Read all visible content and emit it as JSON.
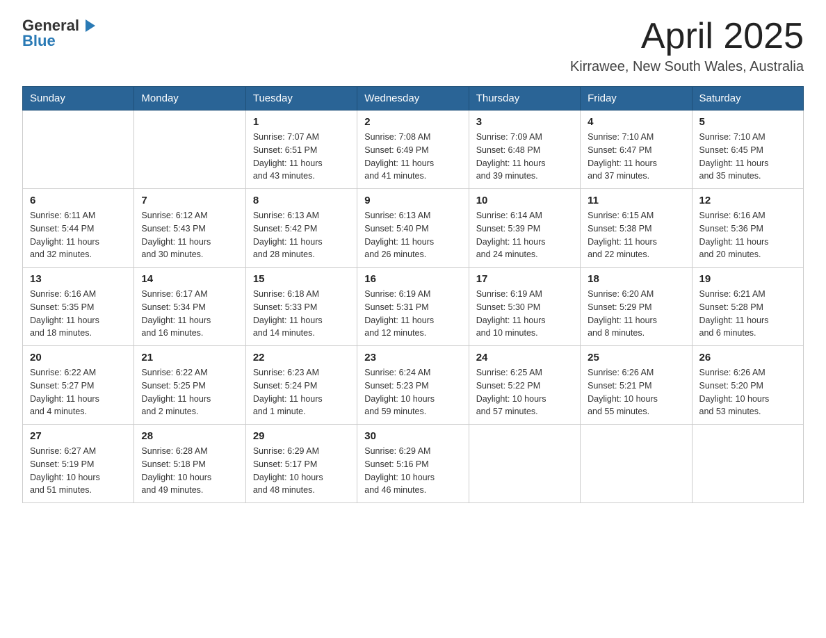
{
  "logo": {
    "general": "General",
    "blue": "Blue"
  },
  "header": {
    "month": "April 2025",
    "location": "Kirrawee, New South Wales, Australia"
  },
  "days_of_week": [
    "Sunday",
    "Monday",
    "Tuesday",
    "Wednesday",
    "Thursday",
    "Friday",
    "Saturday"
  ],
  "weeks": [
    [
      {
        "day": "",
        "info": ""
      },
      {
        "day": "",
        "info": ""
      },
      {
        "day": "1",
        "info": "Sunrise: 7:07 AM\nSunset: 6:51 PM\nDaylight: 11 hours\nand 43 minutes."
      },
      {
        "day": "2",
        "info": "Sunrise: 7:08 AM\nSunset: 6:49 PM\nDaylight: 11 hours\nand 41 minutes."
      },
      {
        "day": "3",
        "info": "Sunrise: 7:09 AM\nSunset: 6:48 PM\nDaylight: 11 hours\nand 39 minutes."
      },
      {
        "day": "4",
        "info": "Sunrise: 7:10 AM\nSunset: 6:47 PM\nDaylight: 11 hours\nand 37 minutes."
      },
      {
        "day": "5",
        "info": "Sunrise: 7:10 AM\nSunset: 6:45 PM\nDaylight: 11 hours\nand 35 minutes."
      }
    ],
    [
      {
        "day": "6",
        "info": "Sunrise: 6:11 AM\nSunset: 5:44 PM\nDaylight: 11 hours\nand 32 minutes."
      },
      {
        "day": "7",
        "info": "Sunrise: 6:12 AM\nSunset: 5:43 PM\nDaylight: 11 hours\nand 30 minutes."
      },
      {
        "day": "8",
        "info": "Sunrise: 6:13 AM\nSunset: 5:42 PM\nDaylight: 11 hours\nand 28 minutes."
      },
      {
        "day": "9",
        "info": "Sunrise: 6:13 AM\nSunset: 5:40 PM\nDaylight: 11 hours\nand 26 minutes."
      },
      {
        "day": "10",
        "info": "Sunrise: 6:14 AM\nSunset: 5:39 PM\nDaylight: 11 hours\nand 24 minutes."
      },
      {
        "day": "11",
        "info": "Sunrise: 6:15 AM\nSunset: 5:38 PM\nDaylight: 11 hours\nand 22 minutes."
      },
      {
        "day": "12",
        "info": "Sunrise: 6:16 AM\nSunset: 5:36 PM\nDaylight: 11 hours\nand 20 minutes."
      }
    ],
    [
      {
        "day": "13",
        "info": "Sunrise: 6:16 AM\nSunset: 5:35 PM\nDaylight: 11 hours\nand 18 minutes."
      },
      {
        "day": "14",
        "info": "Sunrise: 6:17 AM\nSunset: 5:34 PM\nDaylight: 11 hours\nand 16 minutes."
      },
      {
        "day": "15",
        "info": "Sunrise: 6:18 AM\nSunset: 5:33 PM\nDaylight: 11 hours\nand 14 minutes."
      },
      {
        "day": "16",
        "info": "Sunrise: 6:19 AM\nSunset: 5:31 PM\nDaylight: 11 hours\nand 12 minutes."
      },
      {
        "day": "17",
        "info": "Sunrise: 6:19 AM\nSunset: 5:30 PM\nDaylight: 11 hours\nand 10 minutes."
      },
      {
        "day": "18",
        "info": "Sunrise: 6:20 AM\nSunset: 5:29 PM\nDaylight: 11 hours\nand 8 minutes."
      },
      {
        "day": "19",
        "info": "Sunrise: 6:21 AM\nSunset: 5:28 PM\nDaylight: 11 hours\nand 6 minutes."
      }
    ],
    [
      {
        "day": "20",
        "info": "Sunrise: 6:22 AM\nSunset: 5:27 PM\nDaylight: 11 hours\nand 4 minutes."
      },
      {
        "day": "21",
        "info": "Sunrise: 6:22 AM\nSunset: 5:25 PM\nDaylight: 11 hours\nand 2 minutes."
      },
      {
        "day": "22",
        "info": "Sunrise: 6:23 AM\nSunset: 5:24 PM\nDaylight: 11 hours\nand 1 minute."
      },
      {
        "day": "23",
        "info": "Sunrise: 6:24 AM\nSunset: 5:23 PM\nDaylight: 10 hours\nand 59 minutes."
      },
      {
        "day": "24",
        "info": "Sunrise: 6:25 AM\nSunset: 5:22 PM\nDaylight: 10 hours\nand 57 minutes."
      },
      {
        "day": "25",
        "info": "Sunrise: 6:26 AM\nSunset: 5:21 PM\nDaylight: 10 hours\nand 55 minutes."
      },
      {
        "day": "26",
        "info": "Sunrise: 6:26 AM\nSunset: 5:20 PM\nDaylight: 10 hours\nand 53 minutes."
      }
    ],
    [
      {
        "day": "27",
        "info": "Sunrise: 6:27 AM\nSunset: 5:19 PM\nDaylight: 10 hours\nand 51 minutes."
      },
      {
        "day": "28",
        "info": "Sunrise: 6:28 AM\nSunset: 5:18 PM\nDaylight: 10 hours\nand 49 minutes."
      },
      {
        "day": "29",
        "info": "Sunrise: 6:29 AM\nSunset: 5:17 PM\nDaylight: 10 hours\nand 48 minutes."
      },
      {
        "day": "30",
        "info": "Sunrise: 6:29 AM\nSunset: 5:16 PM\nDaylight: 10 hours\nand 46 minutes."
      },
      {
        "day": "",
        "info": ""
      },
      {
        "day": "",
        "info": ""
      },
      {
        "day": "",
        "info": ""
      }
    ]
  ]
}
